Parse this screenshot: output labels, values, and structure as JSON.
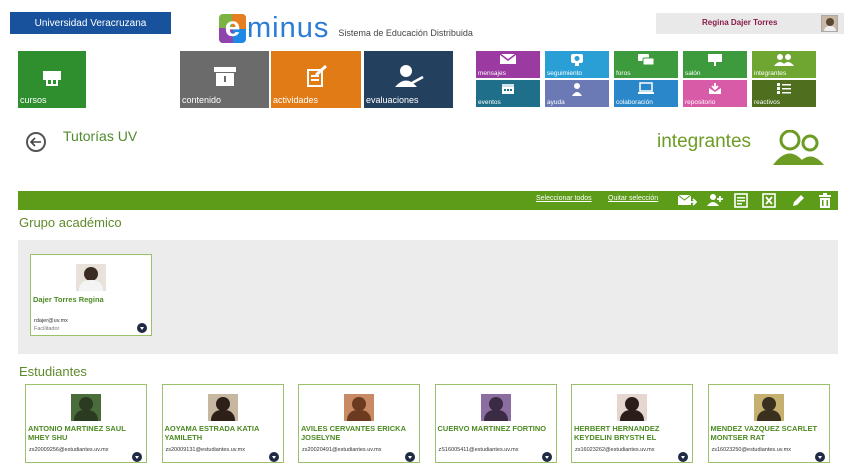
{
  "header": {
    "university": "Universidad Veracruzana",
    "logo_letter": "e",
    "logo_word": "minus",
    "logo_subtitle": "Sistema de Educación Distribuida",
    "user_name": "Regina Dajer Torres"
  },
  "main_tiles": [
    {
      "label": "cursos",
      "icon": "presentation-board-icon",
      "color": "#2f8f2f"
    },
    {
      "label": "contenido",
      "icon": "folder-content-icon",
      "color": "#6b6b6b"
    },
    {
      "label": "actividades",
      "icon": "pencil-sheet-icon",
      "color": "#e07b16"
    },
    {
      "label": "evaluaciones",
      "icon": "user-check-icon",
      "color": "#23405f"
    }
  ],
  "small_tiles": [
    {
      "label": "mensajes",
      "icon": "envelope-icon",
      "color": "#9b3aa1"
    },
    {
      "label": "seguimiento",
      "icon": "tracking-icon",
      "color": "#2a9fd6"
    },
    {
      "label": "foros",
      "icon": "chat-bubbles-icon",
      "color": "#3d9b3d"
    },
    {
      "label": "salón",
      "icon": "whiteboard-icon",
      "color": "#3d9b3d"
    },
    {
      "label": "integrantes",
      "icon": "members-icon",
      "color": "#6fa632"
    },
    {
      "label": "eventos",
      "icon": "calendar-icon",
      "color": "#1f6f8a"
    },
    {
      "label": "ayuda",
      "icon": "help-person-icon",
      "color": "#6b7ab5"
    },
    {
      "label": "colaboración",
      "icon": "laptop-icon",
      "color": "#2a87c9"
    },
    {
      "label": "repositorio",
      "icon": "repository-icon",
      "color": "#d85ba7"
    },
    {
      "label": "reactivos",
      "icon": "checklist-icon",
      "color": "#4f6f1f"
    }
  ],
  "page": {
    "course_title": "Tutorías UV",
    "section_title": "integrantes"
  },
  "toolbar": {
    "select_all": "Seleccionar todos",
    "clear_selection": "Quitar selección",
    "icons": [
      "send-mail-icon",
      "add-user-icon",
      "report-icon",
      "excel-export-icon",
      "edit-icon",
      "delete-icon"
    ]
  },
  "academic_group": {
    "heading": "Grupo académico",
    "members": [
      {
        "name": "Dajer Torres Regina",
        "email": "rdajer@uv.mx",
        "role": "Facilitador"
      }
    ]
  },
  "students": {
    "heading": "Estudiantes",
    "members": [
      {
        "name": "ANTONIO MARTINEZ SAUL MHEY SHU",
        "email": "zs20009256@estudiantes.uv.mx"
      },
      {
        "name": "AOYAMA ESTRADA KATIA YAMILETH",
        "email": "zs20009131@estudiantes.uv.mx"
      },
      {
        "name": "AVILES CERVANTES ERICKA JOSELYNE",
        "email": "zs20020491@estudiantes.uv.mx"
      },
      {
        "name": "CUERVO MARTINEZ FORTINO",
        "email": "zS16005411@estudiantes.uv.mx"
      },
      {
        "name": "HERBERT HERNANDEZ KEYDELIN BRYSTH EL",
        "email": "zs16023262@estudiantes.uv.mx"
      },
      {
        "name": "MENDEZ VAZQUEZ SCARLET MONTSER RAT",
        "email": "zs16023250@estudiantes.uv.mx"
      }
    ]
  }
}
